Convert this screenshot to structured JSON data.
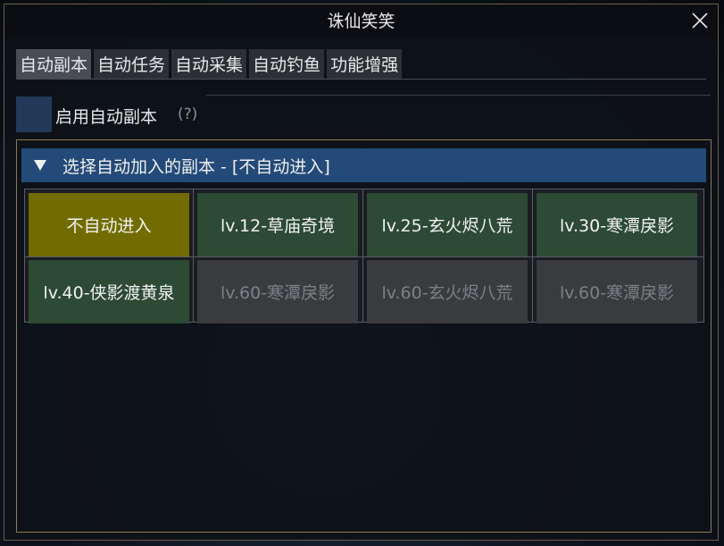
{
  "window": {
    "title": "诛仙笑笑"
  },
  "tabs": [
    {
      "label": "自动副本",
      "active": true
    },
    {
      "label": "自动任务",
      "active": false
    },
    {
      "label": "自动采集",
      "active": false
    },
    {
      "label": "自动钓鱼",
      "active": false
    },
    {
      "label": "功能增强",
      "active": false
    }
  ],
  "enable_checkbox": {
    "label": "启用自动副本",
    "help": "(?)",
    "checked": false
  },
  "dungeon_select": {
    "header": "选择自动加入的副本 - [不自动进入]",
    "expanded": true,
    "options": [
      {
        "label": "不自动进入",
        "state": "selected"
      },
      {
        "label": "lv.12-草庙奇境",
        "state": "available"
      },
      {
        "label": "lv.25-玄火烬八荒",
        "state": "available"
      },
      {
        "label": "lv.30-寒潭戾影",
        "state": "available"
      },
      {
        "label": "lv.40-侠影渡黄泉",
        "state": "available"
      },
      {
        "label": "lv.60-寒潭戾影",
        "state": "locked"
      },
      {
        "label": "lv.60-玄火烬八荒",
        "state": "locked"
      },
      {
        "label": "lv.60-寒潭戾影",
        "state": "locked"
      }
    ]
  },
  "colors": {
    "selected": "#726c00",
    "available": "#2c4a34",
    "locked": "#3a3b3e",
    "header": "#234a78",
    "checkbox": "#22395a",
    "border_gold": "#8a7a55"
  },
  "icons": {
    "close": "close-icon",
    "collapse": "triangle-down-icon"
  }
}
